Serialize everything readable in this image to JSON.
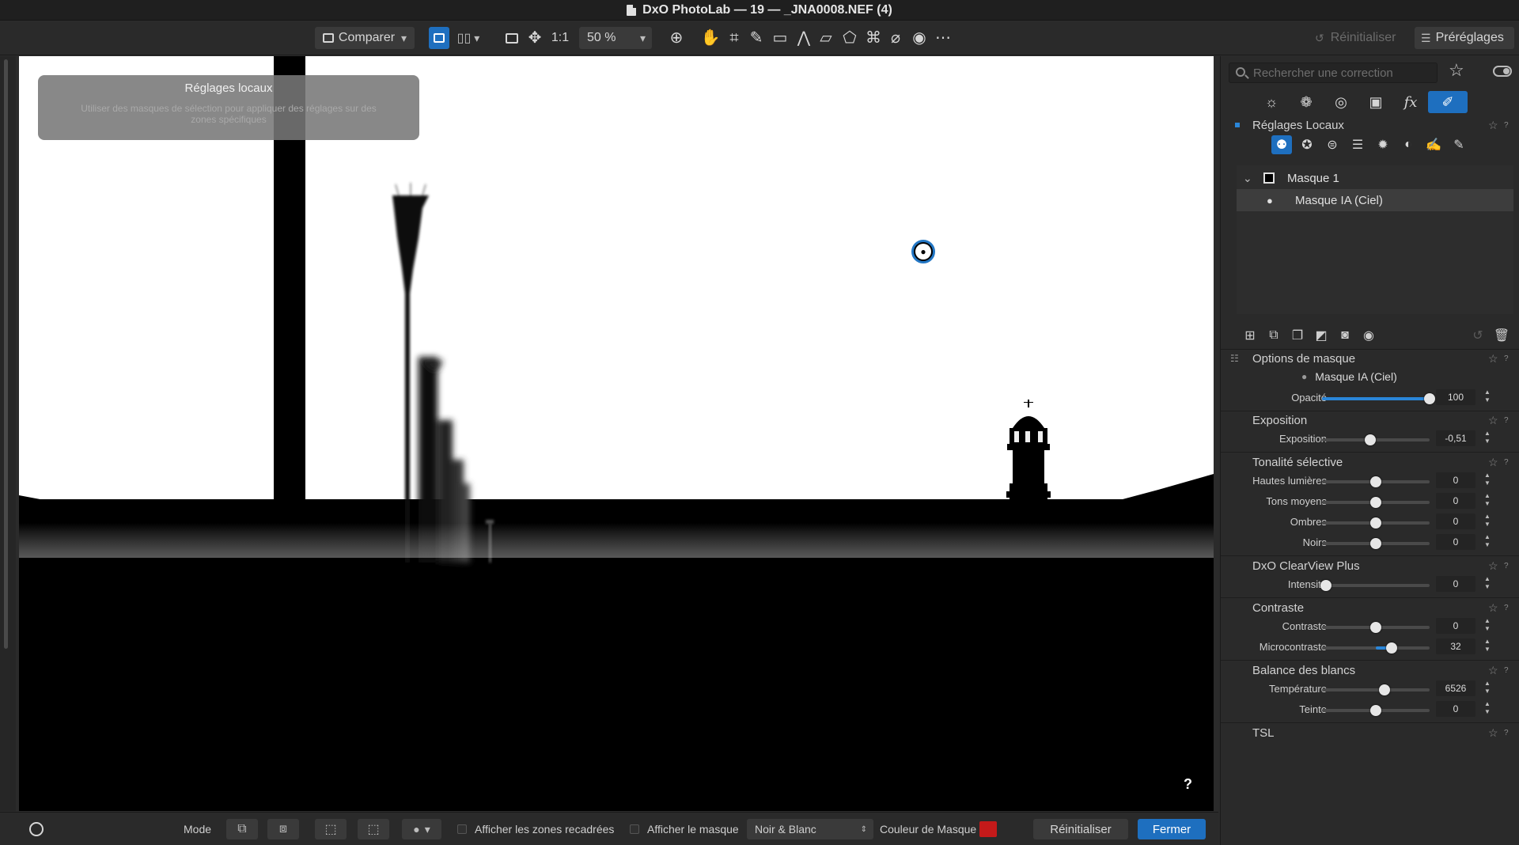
{
  "window": {
    "title": "DxO PhotoLab — 19 — _JNA0008.NEF (4)"
  },
  "toolbar": {
    "compare_label": "Comparer",
    "one_to_one": "1:1",
    "zoom": "50 %",
    "reset_label": "Réinitialiser",
    "presets_label": "Préréglages"
  },
  "overlay": {
    "title": "Réglages locaux",
    "description": "Utiliser des masques de sélection pour appliquer des réglages sur des zones spécifiques"
  },
  "viewer": {
    "help": "?"
  },
  "bottombar": {
    "mode_label": "Mode",
    "show_cropped": "Afficher les zones recadrées",
    "show_mask": "Afficher le masque",
    "mask_display": "Noir & Blanc",
    "mask_color_label": "Couleur de Masque",
    "mask_color": "#c41a1a",
    "reset": "Réinitialiser",
    "close": "Fermer"
  },
  "panel": {
    "search_placeholder": "Rechercher une correction",
    "section_local": "Réglages Locaux",
    "masks": [
      {
        "name": "Masque 1"
      },
      {
        "name": "Masque IA (Ciel)"
      }
    ],
    "mask_options": {
      "title": "Options de masque",
      "mask_name": "Masque IA (Ciel)",
      "opacity_label": "Opacité",
      "opacity": "100",
      "opacity_pct": 100
    },
    "exposure": {
      "title": "Exposition",
      "label": "Exposition",
      "value": "-0,51",
      "pos": 0.45
    },
    "selective_tone": {
      "title": "Tonalité sélective",
      "rows": [
        {
          "label": "Hautes lumières",
          "value": "0",
          "pos": 0.5
        },
        {
          "label": "Tons moyens",
          "value": "0",
          "pos": 0.5
        },
        {
          "label": "Ombres",
          "value": "0",
          "pos": 0.5
        },
        {
          "label": "Noirs",
          "value": "0",
          "pos": 0.5
        }
      ]
    },
    "clearview": {
      "title": "DxO ClearView Plus",
      "label": "Intensité",
      "value": "0",
      "pos": 0.04
    },
    "contrast": {
      "title": "Contraste",
      "rows": [
        {
          "label": "Contraste",
          "value": "0",
          "pos": 0.5
        },
        {
          "label": "Microcontraste",
          "value": "32",
          "pos": 0.65
        }
      ]
    },
    "white_balance": {
      "title": "Balance des blancs",
      "rows": [
        {
          "label": "Température",
          "value": "6526",
          "pos": 0.58
        },
        {
          "label": "Teinte",
          "value": "0",
          "pos": 0.5
        }
      ]
    },
    "hsl": {
      "title": "TSL"
    }
  }
}
